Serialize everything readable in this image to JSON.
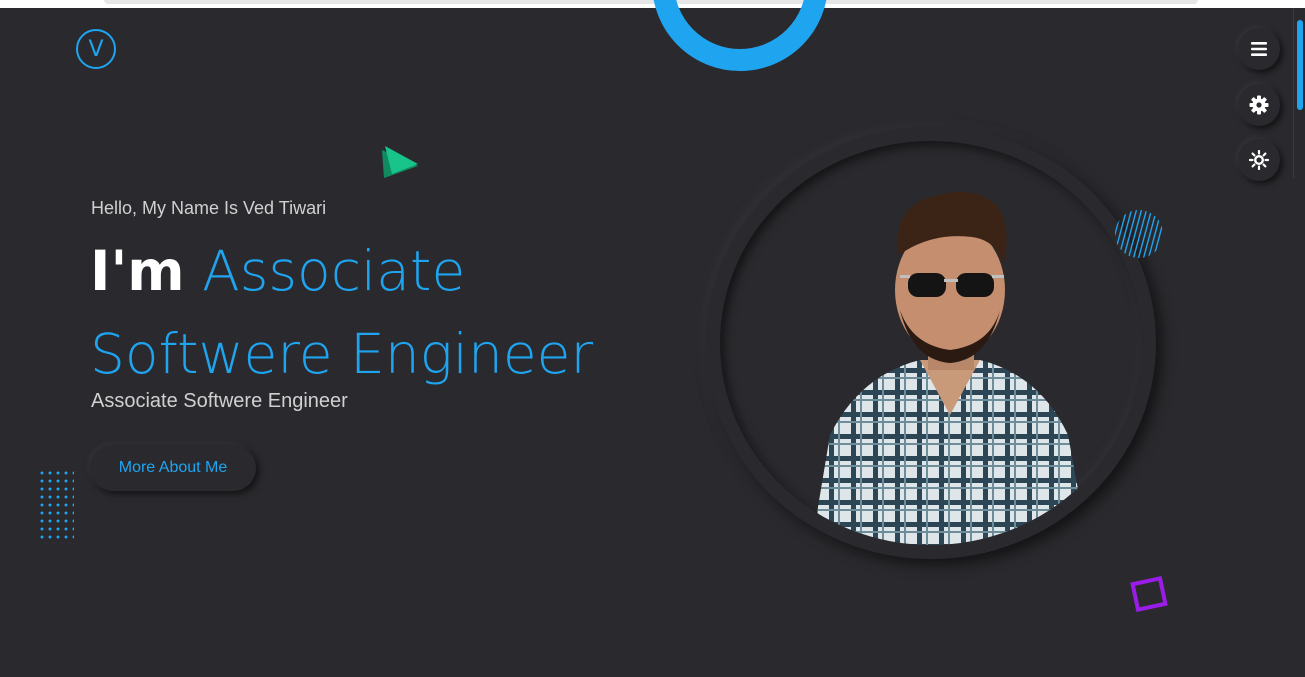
{
  "logo": {
    "letter": "V"
  },
  "side_actions": [
    {
      "icon": "menu-icon"
    },
    {
      "icon": "gear-icon"
    },
    {
      "icon": "sun-icon"
    }
  ],
  "hero": {
    "greeting": "Hello, My Name Is Ved Tiwari",
    "title_prefix": "I'm",
    "title_role": "Associate Softwere Engineer",
    "subtitle": "Associate Softwere Engineer",
    "cta_label": "More About Me"
  },
  "colors": {
    "background": "#2a2a2e",
    "accent": "#1fa4f0",
    "decor_green": "#19c48a",
    "decor_purple": "#9a1ce8"
  }
}
